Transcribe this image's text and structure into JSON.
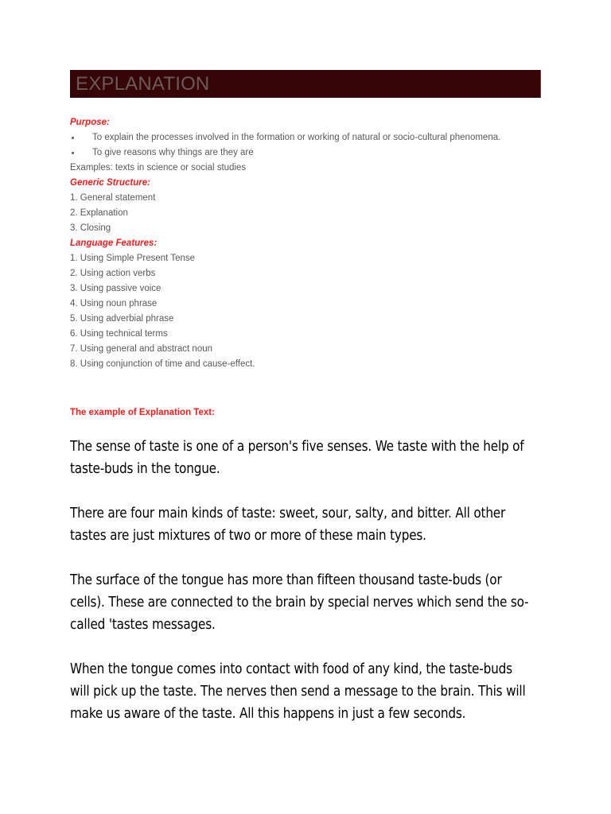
{
  "document": {
    "title": "EXPLANATION",
    "title_bar_color": "#360606",
    "title_text_color": "#6b5a5a",
    "accent_color": "#ff1a1a",
    "body_text_color": "#58595b",
    "example_text_color": "#000000"
  },
  "sections": {
    "purpose": {
      "heading": "Purpose:",
      "bullets": [
        "To explain the processes involved in the formation or working of natural or socio-cultural phenomena.",
        "To give reasons why things are they are"
      ],
      "examples_line": "Examples: texts in science or social studies"
    },
    "generic_structure": {
      "heading": "Generic Structure:",
      "items": [
        "1. General statement",
        "2. Explanation",
        "3. Closing"
      ]
    },
    "language_features": {
      "heading": "Language Features:",
      "items": [
        "1. Using Simple Present Tense",
        "2. Using action verbs",
        "3. Using passive voice",
        "4. Using noun phrase",
        "5. Using adverbial phrase",
        "6. Using technical terms",
        "7. Using general and abstract noun",
        "8. Using conjunction of time and cause-effect."
      ]
    },
    "example": {
      "heading": "The example of Explanation Text:",
      "paragraphs": [
        "The sense of taste is one of a person's five senses. We taste with the help of taste-buds in the tongue.",
        "There are four main kinds of taste: sweet, sour, salty, and bitter. All other tastes are just mixtures of two or more of these main types.",
        "The surface of the tongue has more than fifteen thousand taste-buds (or cells). These are connected to the brain by special nerves which send the so-called 'tastes messages.",
        "When the tongue comes into contact with food of any kind, the taste-buds will pick up the taste. The nerves then send a message to the brain. This will make us aware of the taste. All this happens in just a few seconds."
      ]
    }
  }
}
